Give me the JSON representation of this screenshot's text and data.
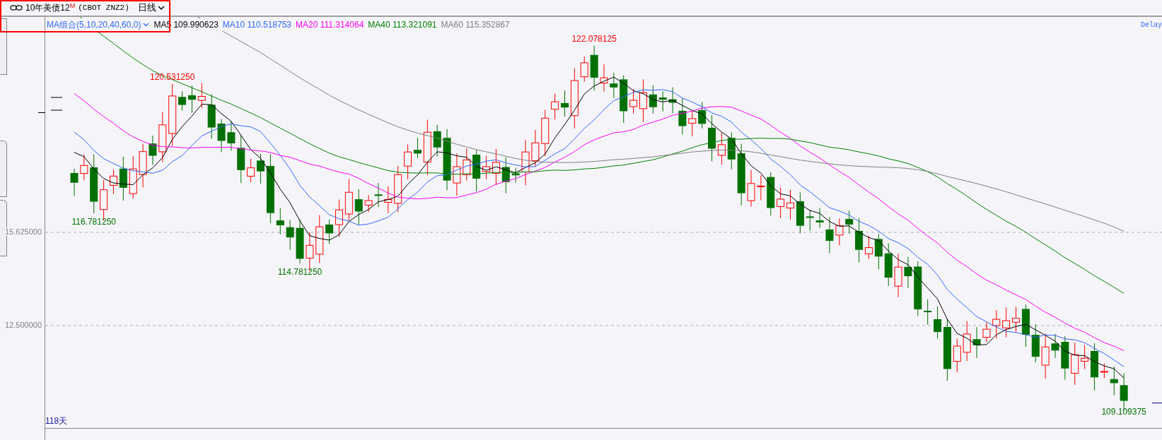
{
  "header": {
    "instrument": "10年美债12$^{M}$",
    "contract": "(CBOT ZNZ2)",
    "period": "日线"
  },
  "legend": {
    "group": "MA组合(5,10,20,40,60,0)",
    "items": [
      {
        "label": "MA5 109.990623",
        "color": "#000000"
      },
      {
        "label": "MA10 110.518753",
        "color": "#3366ff"
      },
      {
        "label": "MA20 111.314064",
        "color": "#ff00ff"
      },
      {
        "label": "MA40 113.321091",
        "color": "#008000"
      },
      {
        "label": "MA60 115.352867",
        "color": "#808080"
      }
    ]
  },
  "delay": "Delay",
  "y_axis_labels": [
    "15.625000",
    "12.500000"
  ],
  "annotations": [
    {
      "kind": "high",
      "text": "120.531250"
    },
    {
      "kind": "low",
      "text": "116.781250"
    },
    {
      "kind": "low",
      "text": "114.781250"
    },
    {
      "kind": "high",
      "text": "122.078125"
    },
    {
      "kind": "low",
      "text": "109.109375"
    }
  ],
  "day_count": "118天"
}
